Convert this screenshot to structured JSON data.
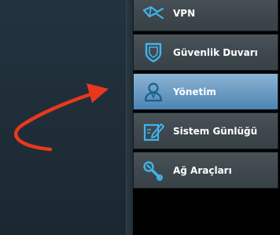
{
  "menu": {
    "items": [
      {
        "label": "VPN",
        "icon": "vpn-icon",
        "active": false
      },
      {
        "label": "Güvenlik Duvarı",
        "icon": "firewall-shield-icon",
        "active": false
      },
      {
        "label": "Yönetim",
        "icon": "user-administration-icon",
        "active": true
      },
      {
        "label": "Sistem Günlüğü",
        "icon": "system-log-edit-icon",
        "active": false
      },
      {
        "label": "Ağ Araçları",
        "icon": "network-tools-wrench-icon",
        "active": false
      }
    ]
  },
  "annotation": {
    "arrow_color": "#e8381e",
    "icon_color": "#3fb4ea"
  }
}
